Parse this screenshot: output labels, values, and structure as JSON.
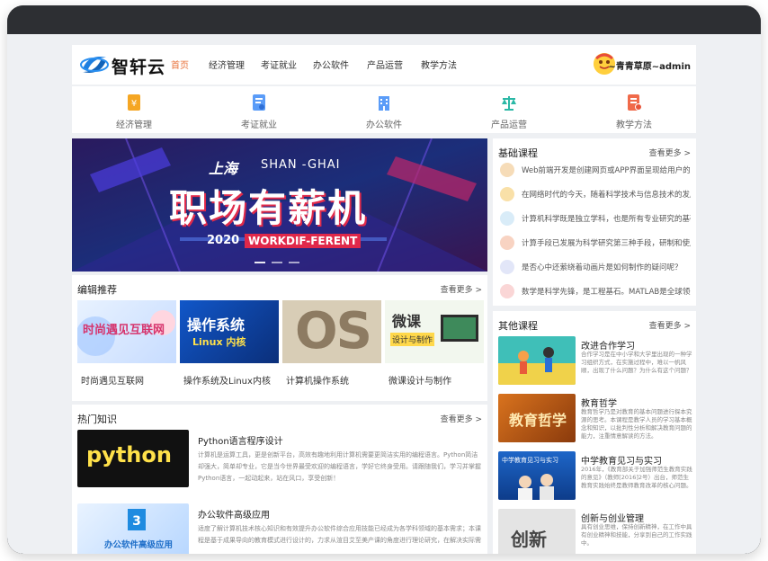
{
  "site": {
    "brand": "智轩云"
  },
  "nav": {
    "items": [
      {
        "label": "首页",
        "active": true
      },
      {
        "label": "经济管理"
      },
      {
        "label": "考证就业"
      },
      {
        "label": "办公软件"
      },
      {
        "label": "产品运营"
      },
      {
        "label": "教学方法"
      }
    ]
  },
  "user": {
    "name": "~青青草原~admin"
  },
  "categories": [
    {
      "label": "经济管理",
      "icon": "money-icon",
      "color": "#f5a623"
    },
    {
      "label": "考证就业",
      "icon": "certificate-icon",
      "color": "#4f8ef7"
    },
    {
      "label": "办公软件",
      "icon": "building-icon",
      "color": "#4f8ef7"
    },
    {
      "label": "产品运营",
      "icon": "scale-icon",
      "color": "#2bb8a6"
    },
    {
      "label": "教学方法",
      "icon": "document-icon",
      "color": "#f06a4a"
    }
  ],
  "banner": {
    "city": "上海",
    "city_en": "SHAN -GHAI",
    "headline": "职场有薪机",
    "year": "2020",
    "tag": "WORKDIF-FERENT"
  },
  "editor": {
    "title": "编辑推荐",
    "more": "查看更多 >",
    "items": [
      {
        "caption": "时尚遇见互联网",
        "art": "时尚遇见互联网"
      },
      {
        "caption": "操作系统及Linux内核",
        "art": "操作系统",
        "art2": "Linux 内核"
      },
      {
        "caption": "计算机操作系统",
        "art": "OS"
      },
      {
        "caption": "微课设计与制作",
        "art": "微课",
        "art2": "设计与制作"
      }
    ]
  },
  "hot": {
    "title": "热门知识",
    "more": "查看更多 >",
    "items": [
      {
        "title": "Python语言程序设计",
        "art": "python",
        "desc": "计算机是运算工具，更是创新平台，高效有趣地利用计算机需要更简洁实用的编程语言。Python简洁却强大，简单却专业，它是当今世界最受欢迎的编程语言，学好它终身受用。请跟随我们，学习并掌握Python语言，一起动起来，站在风口，享受创新！"
      },
      {
        "title": "办公软件高级应用",
        "art": "办公软件高级应用",
        "desc": "适度了解计算机技术核心知识和有效提升办公软件综合应用技能已经成为各学科领域的基本需求；本课程是基于成果导向的教育模式进行设计的，力求从渲目艾至美产课的角度进行理论研究，在解决实际需"
      }
    ]
  },
  "basic": {
    "title": "基础课程",
    "more": "查看更多 >",
    "items": [
      {
        "text": "Web前端开发是创建网页或APP界面呈现给用户的过程"
      },
      {
        "text": "在网络时代的今天，随着科学技术与信息技术的发展"
      },
      {
        "text": "计算机科学既是独立学科，也是所有专业研究的基础"
      },
      {
        "text": "计算手段已发展为科学研究第三种手段，研制和使用"
      },
      {
        "text": "是否心中还萦绕着动画片是如何制作的疑问呢？"
      },
      {
        "text": "数学是科学先锋，是工程基石。MATLAB是全球领先"
      }
    ]
  },
  "other": {
    "title": "其他课程",
    "more": "查看更多 >",
    "items": [
      {
        "title": "改进合作学习",
        "desc": "合作学习是在中小学和大学里出现的一种学习组织方式，在实施过程中，难以一帆风顺，出现了什么问题？为什么有这个问题？"
      },
      {
        "title": "教育哲学",
        "art": "教育哲学",
        "desc": "教育哲学乃是对教育的基本问题进行探本究源的思考。本课程是教学人员的学习基本概念和知识，以批判性分析和解决教育问题的能力，注重情意解读的方法。"
      },
      {
        "title": "中学教育见习与实习",
        "art": "中学教育见习与实习",
        "desc": "2016年，《教育部关于加强师范生教育实践的意见》（教师[2016]2号）出台，师范生教育实践始终是教师教育改革的核心问题。"
      },
      {
        "title": "创新与创业管理",
        "art": "创新",
        "desc": "具有创业思维，保持创新精神，在工作中具有创业精神和技能，分享到自己的工作实践中。"
      }
    ]
  },
  "colors": {
    "accent": "#e8713a",
    "page_bg": "#eef0f3",
    "frame": "#2d2f33"
  }
}
